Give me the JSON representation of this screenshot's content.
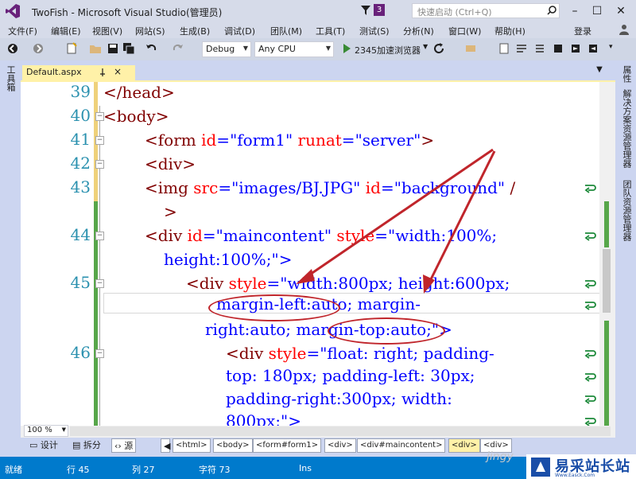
{
  "window": {
    "title": "TwoFish - Microsoft Visual Studio(管理员)",
    "notification_count": "3",
    "quick_launch_placeholder": "快速启动 (Ctrl+Q)",
    "login_label": "登录"
  },
  "menu": [
    "文件(F)",
    "编辑(E)",
    "视图(V)",
    "网站(S)",
    "生成(B)",
    "调试(D)",
    "团队(M)",
    "工具(T)",
    "测试(S)",
    "分析(N)",
    "窗口(W)",
    "帮助(H)"
  ],
  "toolbar": {
    "config": "Debug",
    "platform": "Any CPU",
    "run_target": "2345加速浏览器"
  },
  "panels": {
    "toolbox": "工具箱",
    "properties": "属性",
    "solution_explorer": "解决方案资源管理器",
    "team_explorer": "团队资源管理器"
  },
  "document_tab": {
    "name": "Default.aspx"
  },
  "code": {
    "l39_no": "39",
    "l39_a": "</head>",
    "l40_no": "40",
    "l40_a": "<body>",
    "l41_no": "41",
    "l41": {
      "t1": "<form ",
      "a1": "id",
      "e1": "=",
      "v1": "\"form1\"",
      "a2": " runat",
      "e2": "=",
      "v2": "\"server\"",
      "t2": ">"
    },
    "l42_no": "42",
    "l42": "<div>",
    "l43_no": "43",
    "l43": {
      "t1": "<img ",
      "a1": "src",
      "e1": "=",
      "v1": "\"images/BJ.JPG\"",
      "a2": " id",
      "e2": "=",
      "v2": "\"background\"",
      "t2": " /"
    },
    "l43b": ">",
    "l44_no": "44",
    "l44": {
      "t1": "<div ",
      "a1": "id",
      "e1": "=",
      "v1": "\"maincontent\"",
      "a2": " style",
      "e2": "=",
      "v2": "\"width:100%;"
    },
    "l44b": "height:100%;\">",
    "l45_no": "45",
    "l45": {
      "t1": "<div ",
      "a1": "style",
      "e1": "=",
      "v1": "\"width:800px; height:600px;"
    },
    "l45b": "margin-left:auto; margin-",
    "l45c": "right:auto; margin-top:auto;\">",
    "l46_no": "46",
    "l46": {
      "t1": "<div ",
      "a1": "style",
      "e1": "=",
      "v1": "\"float: right; padding-"
    },
    "l46b": "top: 180px; padding-left: 30px;",
    "l46c": "padding-right:300px; width:",
    "l46d": "800px;\">"
  },
  "editor_footer": {
    "zoom": "100 %",
    "design": "设计",
    "split": "拆分",
    "source": "源",
    "crumbs": [
      "<html>",
      "<body>",
      "<form#form1>",
      "<div>",
      "<div#maincontent>",
      "<div>",
      "<div>"
    ]
  },
  "status": {
    "ready": "就绪",
    "line": "行 45",
    "col": "列 27",
    "char": "字符 73",
    "mode": "Ins"
  },
  "watermark": {
    "brand": "易采站长站",
    "sub": "Www.Easck.Com",
    "jingyan": "jingy"
  },
  "colors": {
    "accent_statusbar": "#007acc",
    "annotation": "#c0252b",
    "tag": "#800000",
    "attr": "#ff0000",
    "value": "#0000ff",
    "line_number": "#2b91af"
  }
}
